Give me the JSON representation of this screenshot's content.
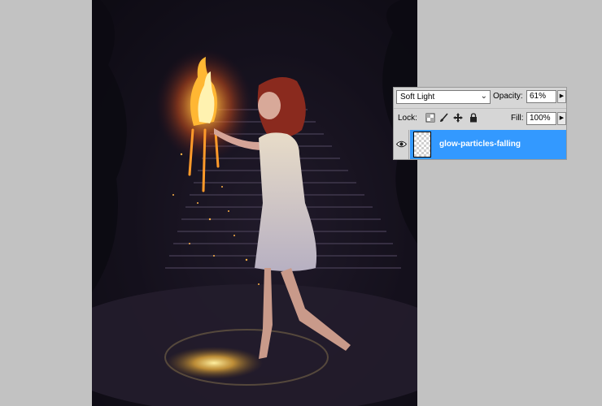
{
  "layers_panel": {
    "blend_mode": "Soft Light",
    "opacity_label": "Opacity:",
    "opacity_value": "61%",
    "lock_label": "Lock:",
    "fill_label": "Fill:",
    "fill_value": "100%",
    "layer": {
      "name": "glow-particles-falling",
      "visible": true,
      "selected": true
    }
  },
  "colors": {
    "workspace_bg": "#c2c2c2",
    "panel_bg": "#d6d6d6",
    "selected_layer": "#3399ff",
    "canvas_dark": "#17121f",
    "fire_orange": "#ff8a1a"
  },
  "icons": {
    "dropdown": "chevron-down-icon",
    "flyout": "triangle-right-icon",
    "visibility": "eye-icon",
    "lock_transparent": "lock-transparent-pixels-icon",
    "lock_image": "brush-icon",
    "lock_position": "move-icon",
    "lock_all": "padlock-icon"
  }
}
